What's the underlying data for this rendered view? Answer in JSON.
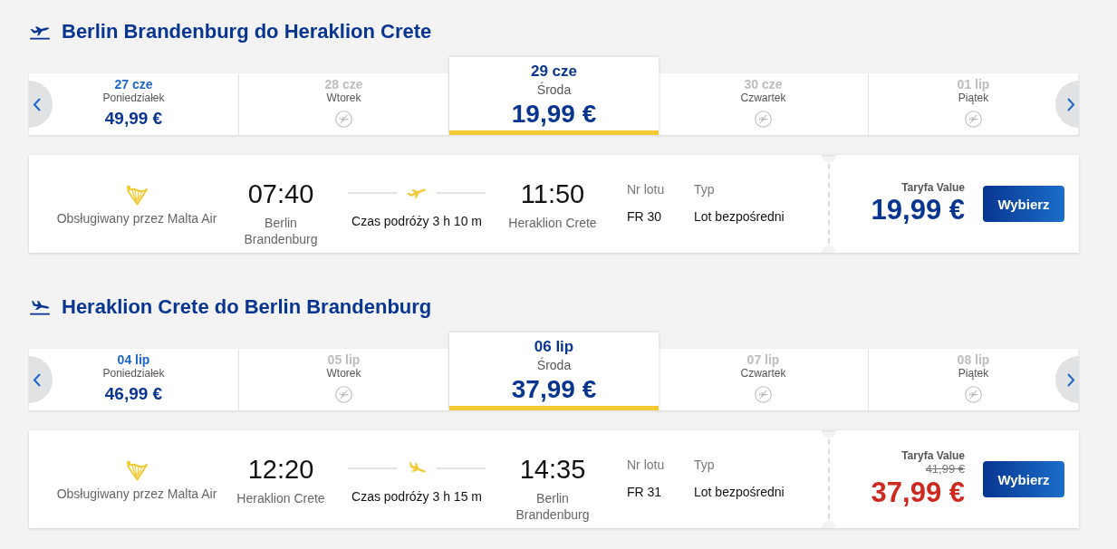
{
  "sections": [
    {
      "kind": "outbound",
      "title": "Berlin Brandenburg do Heraklion Crete",
      "dates": [
        {
          "date": "27 cze",
          "day": "Poniedziałek",
          "price": "49,99 €",
          "available": true,
          "selected": false
        },
        {
          "date": "28 cze",
          "day": "Wtorek",
          "available": false,
          "selected": false
        },
        {
          "date": "29 cze",
          "day": "Środa",
          "price": "19,99 €",
          "available": true,
          "selected": true
        },
        {
          "date": "30 cze",
          "day": "Czwartek",
          "available": false,
          "selected": false
        },
        {
          "date": "01 lip",
          "day": "Piątek",
          "available": false,
          "selected": false
        }
      ],
      "flight": {
        "operator": "Obsługiwany przez Malta Air",
        "depart_time": "07:40",
        "depart_city": "Berlin Brandenburg",
        "duration": "Czas podróży 3 h 10 m",
        "arrive_time": "11:50",
        "arrive_city": "Heraklion Crete",
        "flight_no_label": "Nr lotu",
        "flight_no": "FR 30",
        "type_label": "Typ",
        "type": "Lot bezpośredni",
        "fare_label": "Taryfa Value",
        "price": "19,99 €",
        "button": "Wybierz"
      }
    },
    {
      "kind": "inbound",
      "title": "Heraklion Crete do Berlin Brandenburg",
      "dates": [
        {
          "date": "04 lip",
          "day": "Poniedziałek",
          "price": "46,99 €",
          "available": true,
          "selected": false
        },
        {
          "date": "05 lip",
          "day": "Wtorek",
          "available": false,
          "selected": false
        },
        {
          "date": "06 lip",
          "day": "Środa",
          "price": "37,99 €",
          "available": true,
          "selected": true
        },
        {
          "date": "07 lip",
          "day": "Czwartek",
          "available": false,
          "selected": false
        },
        {
          "date": "08 lip",
          "day": "Piątek",
          "available": false,
          "selected": false
        }
      ],
      "flight": {
        "operator": "Obsługiwany przez Malta Air",
        "depart_time": "12:20",
        "depart_city": "Heraklion Crete",
        "duration": "Czas podróży 3 h 15 m",
        "arrive_time": "14:35",
        "arrive_city": "Berlin Brandenburg",
        "flight_no_label": "Nr lotu",
        "flight_no": "FR 31",
        "type_label": "Typ",
        "type": "Lot bezpośredni",
        "fare_label": "Taryfa Value",
        "old_price": "41,99 €",
        "price": "37,99 €",
        "button": "Wybierz"
      }
    }
  ]
}
